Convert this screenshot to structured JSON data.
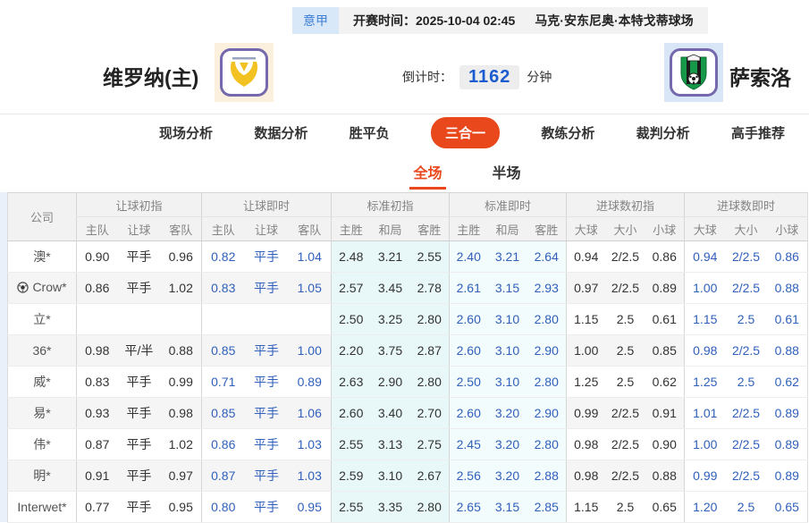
{
  "match_header": {
    "league_badge": "意甲",
    "kickoff_label": "开赛时间：",
    "kickoff_time": "2025-10-04 02:45",
    "venue": "马克·安东尼奥·本特戈蒂球场",
    "home_team": "维罗纳(主)",
    "away_team": "萨索洛",
    "countdown_label": "倒计时：",
    "countdown_value": "1162",
    "countdown_unit": "分钟"
  },
  "nav_tabs": [
    {
      "label": "现场分析",
      "active": false
    },
    {
      "label": "数据分析",
      "active": false
    },
    {
      "label": "胜平负",
      "active": false
    },
    {
      "label": "三合一",
      "active": true
    },
    {
      "label": "教练分析",
      "active": false
    },
    {
      "label": "裁判分析",
      "active": false
    },
    {
      "label": "高手推荐",
      "active": false
    }
  ],
  "sub_tabs": [
    {
      "label": "全场",
      "active": true
    },
    {
      "label": "半场",
      "active": false
    }
  ],
  "colors": {
    "accent_orange": "#e8481c",
    "live_blue": "#3060bb",
    "countdown_blue": "#1b5bd0",
    "std_initial_bg": "#e8f7f7",
    "std_live_bg": "#f3fcfc"
  },
  "table": {
    "company_header": "公司",
    "groups": [
      {
        "label": "让球初指",
        "cols": [
          "主队",
          "让球",
          "客队"
        ],
        "style": "stripe-dark"
      },
      {
        "label": "让球即时",
        "cols": [
          "主队",
          "让球",
          "客队"
        ],
        "style": "stripe-live"
      },
      {
        "label": "标准初指",
        "cols": [
          "主胜",
          "和局",
          "客胜"
        ],
        "style": "cyan1-dark"
      },
      {
        "label": "标准即时",
        "cols": [
          "主胜",
          "和局",
          "客胜"
        ],
        "style": "cyan2-live"
      },
      {
        "label": "进球数初指",
        "cols": [
          "大球",
          "大小",
          "小球"
        ],
        "style": "stripe-dark"
      },
      {
        "label": "进球数即时",
        "cols": [
          "大球",
          "大小",
          "小球"
        ],
        "style": "white-live"
      }
    ],
    "rows": [
      {
        "company": "澳*",
        "has_icon": false,
        "cells": [
          [
            "0.90",
            "平手",
            "0.96"
          ],
          [
            "0.82",
            "平手",
            "1.04"
          ],
          [
            "2.48",
            "3.21",
            "2.55"
          ],
          [
            "2.40",
            "3.21",
            "2.64"
          ],
          [
            "0.94",
            "2/2.5",
            "0.86"
          ],
          [
            "0.94",
            "2/2.5",
            "0.86"
          ]
        ]
      },
      {
        "company": "Crow*",
        "has_icon": true,
        "cells": [
          [
            "0.86",
            "平手",
            "1.02"
          ],
          [
            "0.83",
            "平手",
            "1.05"
          ],
          [
            "2.57",
            "3.45",
            "2.78"
          ],
          [
            "2.61",
            "3.15",
            "2.93"
          ],
          [
            "0.97",
            "2/2.5",
            "0.89"
          ],
          [
            "1.00",
            "2/2.5",
            "0.88"
          ]
        ]
      },
      {
        "company": "立*",
        "has_icon": false,
        "cells": [
          [
            "",
            "",
            ""
          ],
          [
            "",
            "",
            ""
          ],
          [
            "2.50",
            "3.25",
            "2.80"
          ],
          [
            "2.60",
            "3.10",
            "2.80"
          ],
          [
            "1.15",
            "2.5",
            "0.61"
          ],
          [
            "1.15",
            "2.5",
            "0.61"
          ]
        ]
      },
      {
        "company": "36*",
        "has_icon": false,
        "cells": [
          [
            "0.98",
            "平/半",
            "0.88"
          ],
          [
            "0.85",
            "平手",
            "1.00"
          ],
          [
            "2.20",
            "3.75",
            "2.87"
          ],
          [
            "2.60",
            "3.10",
            "2.90"
          ],
          [
            "1.00",
            "2.5",
            "0.85"
          ],
          [
            "0.98",
            "2/2.5",
            "0.88"
          ]
        ]
      },
      {
        "company": "威*",
        "has_icon": false,
        "cells": [
          [
            "0.83",
            "平手",
            "0.99"
          ],
          [
            "0.71",
            "平手",
            "0.89"
          ],
          [
            "2.63",
            "2.90",
            "2.80"
          ],
          [
            "2.50",
            "3.10",
            "2.80"
          ],
          [
            "1.25",
            "2.5",
            "0.62"
          ],
          [
            "1.25",
            "2.5",
            "0.62"
          ]
        ]
      },
      {
        "company": "易*",
        "has_icon": false,
        "cells": [
          [
            "0.93",
            "平手",
            "0.98"
          ],
          [
            "0.85",
            "平手",
            "1.06"
          ],
          [
            "2.60",
            "3.40",
            "2.70"
          ],
          [
            "2.60",
            "3.20",
            "2.90"
          ],
          [
            "0.99",
            "2/2.5",
            "0.91"
          ],
          [
            "1.01",
            "2/2.5",
            "0.89"
          ]
        ]
      },
      {
        "company": "伟*",
        "has_icon": false,
        "cells": [
          [
            "0.87",
            "平手",
            "1.02"
          ],
          [
            "0.86",
            "平手",
            "1.03"
          ],
          [
            "2.55",
            "3.13",
            "2.75"
          ],
          [
            "2.45",
            "3.20",
            "2.80"
          ],
          [
            "0.98",
            "2/2.5",
            "0.90"
          ],
          [
            "1.00",
            "2/2.5",
            "0.89"
          ]
        ]
      },
      {
        "company": "明*",
        "has_icon": false,
        "cells": [
          [
            "0.91",
            "平手",
            "0.97"
          ],
          [
            "0.87",
            "平手",
            "1.03"
          ],
          [
            "2.59",
            "3.10",
            "2.67"
          ],
          [
            "2.56",
            "3.20",
            "2.88"
          ],
          [
            "0.98",
            "2/2.5",
            "0.88"
          ],
          [
            "0.99",
            "2/2.5",
            "0.89"
          ]
        ]
      },
      {
        "company": "Interwet*",
        "has_icon": false,
        "cells": [
          [
            "0.77",
            "平手",
            "0.95"
          ],
          [
            "0.80",
            "平手",
            "0.95"
          ],
          [
            "2.55",
            "3.35",
            "2.80"
          ],
          [
            "2.65",
            "3.15",
            "2.85"
          ],
          [
            "1.15",
            "2.5",
            "0.65"
          ],
          [
            "1.20",
            "2.5",
            "0.65"
          ]
        ]
      }
    ]
  }
}
